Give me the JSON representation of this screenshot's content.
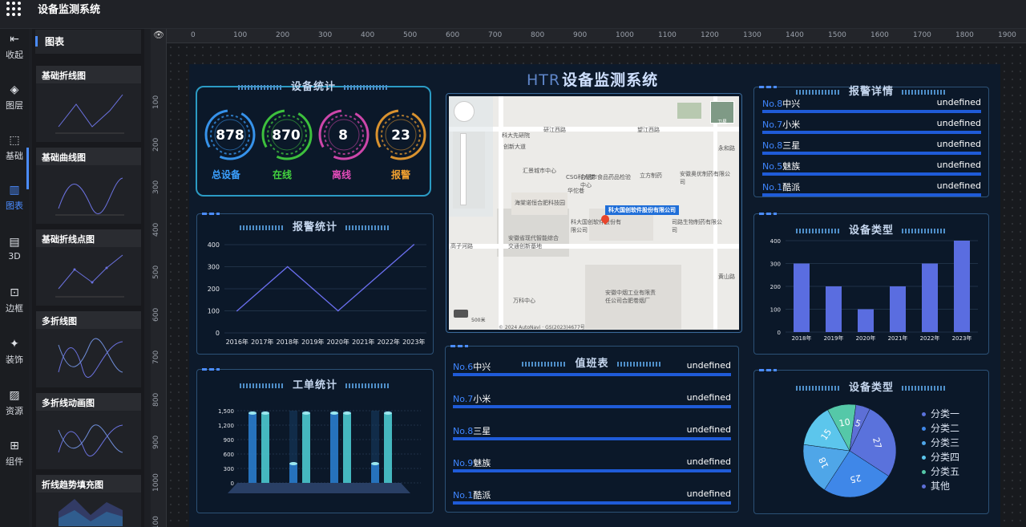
{
  "app": {
    "title": "设备监测系统"
  },
  "nav": [
    {
      "label": "收起",
      "icon": "collapse-icon"
    },
    {
      "label": "图层",
      "icon": "layers-icon"
    },
    {
      "label": "基础",
      "icon": "basic-component-icon"
    },
    {
      "label": "图表",
      "icon": "bar-chart-icon",
      "active": true
    },
    {
      "label": "3D",
      "icon": "3d-chart-icon"
    },
    {
      "label": "边框",
      "icon": "border-icon"
    },
    {
      "label": "装饰",
      "icon": "sparkle-icon"
    },
    {
      "label": "资源",
      "icon": "image-icon"
    },
    {
      "label": "组件",
      "icon": "component-icon"
    }
  ],
  "chart_panel": {
    "title": "图表",
    "items": [
      "基础折线图",
      "基础曲线图",
      "基础折线点图",
      "多折线图",
      "多折线动画图",
      "折线趋势填充图"
    ]
  },
  "ruler_top": [
    "0",
    "100",
    "200",
    "300",
    "400",
    "500",
    "600",
    "700",
    "800",
    "900",
    "1000",
    "1100",
    "1200",
    "1300",
    "1400",
    "1500",
    "1600",
    "1700",
    "1800",
    "1900"
  ],
  "ruler_left": [
    "100",
    "200",
    "300",
    "400",
    "500",
    "600",
    "700",
    "800",
    "900",
    "1000",
    "1100"
  ],
  "screen": {
    "title_logo": "HTR",
    "title": "设备监测系统",
    "device_stats": {
      "title": "设备统计",
      "items": [
        {
          "value": "878",
          "label": "总设备",
          "color": "#3ba0ff"
        },
        {
          "value": "870",
          "label": "在线",
          "color": "#43d33f"
        },
        {
          "value": "8",
          "label": "离线",
          "color": "#e24bb8"
        },
        {
          "value": "23",
          "label": "报警",
          "color": "#f0a030"
        }
      ]
    },
    "alarm_stats": {
      "title": "报警统计"
    },
    "work_order": {
      "title": "工单统计"
    },
    "alarm_detail": {
      "title": "报警详情"
    },
    "device_type_bar": {
      "title": "设备类型"
    },
    "device_type_pie": {
      "title": "设备类型"
    },
    "duty": {
      "title": "值班表"
    },
    "alarm_rank": [
      {
        "no": "No.8",
        "name": "中兴",
        "value": "undefined"
      },
      {
        "no": "No.7",
        "name": "小米",
        "value": "undefined"
      },
      {
        "no": "No.8",
        "name": "三星",
        "value": "undefined"
      },
      {
        "no": "No.5",
        "name": "魅族",
        "value": "undefined"
      },
      {
        "no": "No.1",
        "name": "酷派",
        "value": "undefined"
      }
    ],
    "duty_rank": [
      {
        "no": "No.6",
        "name": "中兴",
        "value": "undefined"
      },
      {
        "no": "No.7",
        "name": "小米",
        "value": "undefined"
      },
      {
        "no": "No.8",
        "name": "三星",
        "value": "undefined"
      },
      {
        "no": "No.9",
        "name": "魅族",
        "value": "undefined"
      },
      {
        "no": "No.1",
        "name": "酷派",
        "value": "undefined"
      }
    ],
    "map": {
      "tooltip": "科大国创软件股份有限公司",
      "labels": [
        "研江西路",
        "望江西路",
        "科大先研院",
        "创新大道",
        "汇景城市中心",
        "CSG科大楼",
        "合肥市食品药品检验中心",
        "华佗巷",
        "立方制药",
        "安徽奥优制药有限公司",
        "海棠诺恒合肥科技园",
        "科大国创软件股份有限公司",
        "司路生物制药有限公司",
        "安徽省现代智能综合交通创新基地",
        "高子河路",
        "万科中心",
        "安徽中烟工业有限责任公司合肥卷烟厂",
        "永和路",
        "黄山路"
      ],
      "copyright": "© 2024 AutoNavi · GS(2023)4677号",
      "scale": "500米",
      "satellite": "卫星"
    }
  },
  "chart_data": [
    {
      "type": "line",
      "title": "报警统计",
      "categories": [
        "2016年",
        "2017年",
        "2018年",
        "2019年",
        "2020年",
        "2021年",
        "2022年",
        "2023年"
      ],
      "values": [
        100,
        200,
        300,
        200,
        100,
        200,
        300,
        400
      ],
      "yticks": [
        "0",
        "100",
        "200",
        "300",
        "400"
      ],
      "ylim": [
        0,
        400
      ],
      "color": "#6b6ff0"
    },
    {
      "type": "bar",
      "title": "工单统计",
      "categories": [
        "",
        "",
        "",
        ""
      ],
      "series": [
        {
          "values": [
            1450,
            400,
            1450,
            400
          ]
        },
        {
          "values": [
            1450,
            1450,
            1450,
            1450
          ]
        }
      ],
      "ylim": [
        0,
        1500
      ],
      "yticks": [
        "0",
        "300",
        "600",
        "900",
        "1,200",
        "1,500"
      ]
    },
    {
      "type": "bar",
      "title": "设备类型",
      "categories": [
        "2018年",
        "2019年",
        "2020年",
        "2021年",
        "2022年",
        "2023年"
      ],
      "values": [
        300,
        200,
        100,
        200,
        300,
        400
      ],
      "ylim": [
        0,
        400
      ],
      "yticks": [
        "0",
        "100",
        "200",
        "300",
        "400"
      ],
      "color": "#5a6de0"
    },
    {
      "type": "pie",
      "title": "设备类型",
      "labels": [
        "分类一",
        "分类二",
        "分类三",
        "分类四",
        "分类五",
        "其他"
      ],
      "values": [
        27,
        25,
        18,
        15,
        10,
        5
      ],
      "colors": [
        "#5a72dc",
        "#3f87e8",
        "#4fa6e8",
        "#5cc6ec",
        "#55c8a8",
        "#5d6fd6"
      ]
    }
  ]
}
